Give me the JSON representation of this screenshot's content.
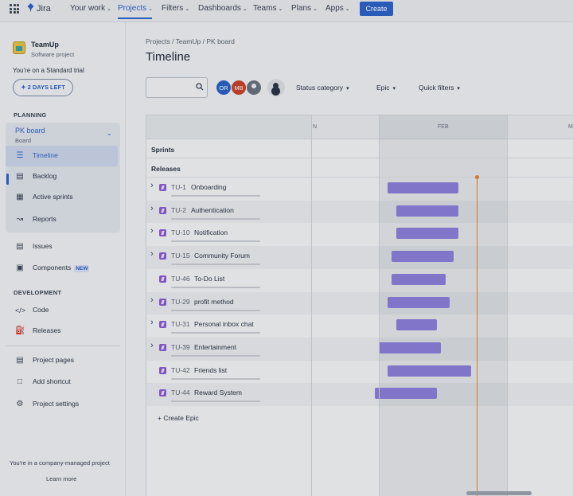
{
  "topnav": {
    "logo": "Jira",
    "items": [
      {
        "label": "Your work"
      },
      {
        "label": "Projects"
      },
      {
        "label": "Filters"
      },
      {
        "label": "Dashboards"
      },
      {
        "label": "Teams"
      },
      {
        "label": "Plans"
      },
      {
        "label": "Apps"
      }
    ],
    "create_label": "Create",
    "accent": "#2f63c9"
  },
  "sidebar": {
    "project_name": "TeamUp",
    "project_type": "Software project",
    "trial_text": "You're on a Standard trial",
    "days_left": "2 DAYS LEFT",
    "planning_heading": "PLANNING",
    "board_name": "PK board",
    "board_sub": "Board",
    "planning_items": [
      {
        "label": "Timeline",
        "icon": "timeline-icon"
      },
      {
        "label": "Backlog",
        "icon": "backlog-icon"
      },
      {
        "label": "Active sprints",
        "icon": "sprint-board-icon"
      },
      {
        "label": "Reports",
        "icon": "reports-icon"
      }
    ],
    "issues": "Issues",
    "components": "Components",
    "components_badge": "NEW",
    "development_heading": "DEVELOPMENT",
    "dev_items": [
      {
        "label": "Code",
        "icon": "code-icon"
      },
      {
        "label": "Releases",
        "icon": "releases-icon"
      }
    ],
    "bottom_items": [
      {
        "label": "Project pages",
        "icon": "pages-icon"
      },
      {
        "label": "Add shortcut",
        "icon": "add-shortcut-icon"
      },
      {
        "label": "Project settings",
        "icon": "gear-icon"
      }
    ],
    "managed_text": "You're in a company-managed project",
    "learn_more": "Learn more"
  },
  "main": {
    "breadcrumb": "Projects  /  TeamUp  /  PK board",
    "title": "Timeline",
    "search_placeholder": "",
    "avatars": [
      "OR",
      "MB"
    ],
    "filters": [
      "Status category",
      "Epic",
      "Quick filters"
    ],
    "months": [
      "N",
      "FEB",
      "M"
    ],
    "sprints_label": "Sprints",
    "releases_label": "Releases",
    "epics": [
      {
        "key": "TU-1",
        "name": "Onboarding",
        "expandable": true,
        "start": 2,
        "end": 18.5
      },
      {
        "key": "TU-2",
        "name": "Authentication",
        "expandable": true,
        "start": 4,
        "end": 18.5
      },
      {
        "key": "TU-10",
        "name": "Notification",
        "expandable": true,
        "start": 4,
        "end": 18.5
      },
      {
        "key": "TU-15",
        "name": "Community Forum",
        "expandable": true,
        "start": 3,
        "end": 17.5
      },
      {
        "key": "TU-46",
        "name": "To-Do List",
        "expandable": false,
        "start": 3,
        "end": 15.5
      },
      {
        "key": "TU-29",
        "name": "profit method",
        "expandable": true,
        "start": 2,
        "end": 16.5
      },
      {
        "key": "TU-31",
        "name": "Personal inbox chat",
        "expandable": true,
        "start": 4,
        "end": 13.5
      },
      {
        "key": "TU-39",
        "name": "Entertainment",
        "expandable": true,
        "start": 0,
        "end": 14.5
      },
      {
        "key": "TU-42",
        "name": "Friends list",
        "expandable": false,
        "start": 2,
        "end": 21.5
      },
      {
        "key": "TU-44",
        "name": "Reward System",
        "expandable": false,
        "start": -1,
        "end": 13.5
      }
    ],
    "create_epic": "Create Epic",
    "bar_color": "#8b7fd9",
    "today_color": "#e8832a"
  }
}
